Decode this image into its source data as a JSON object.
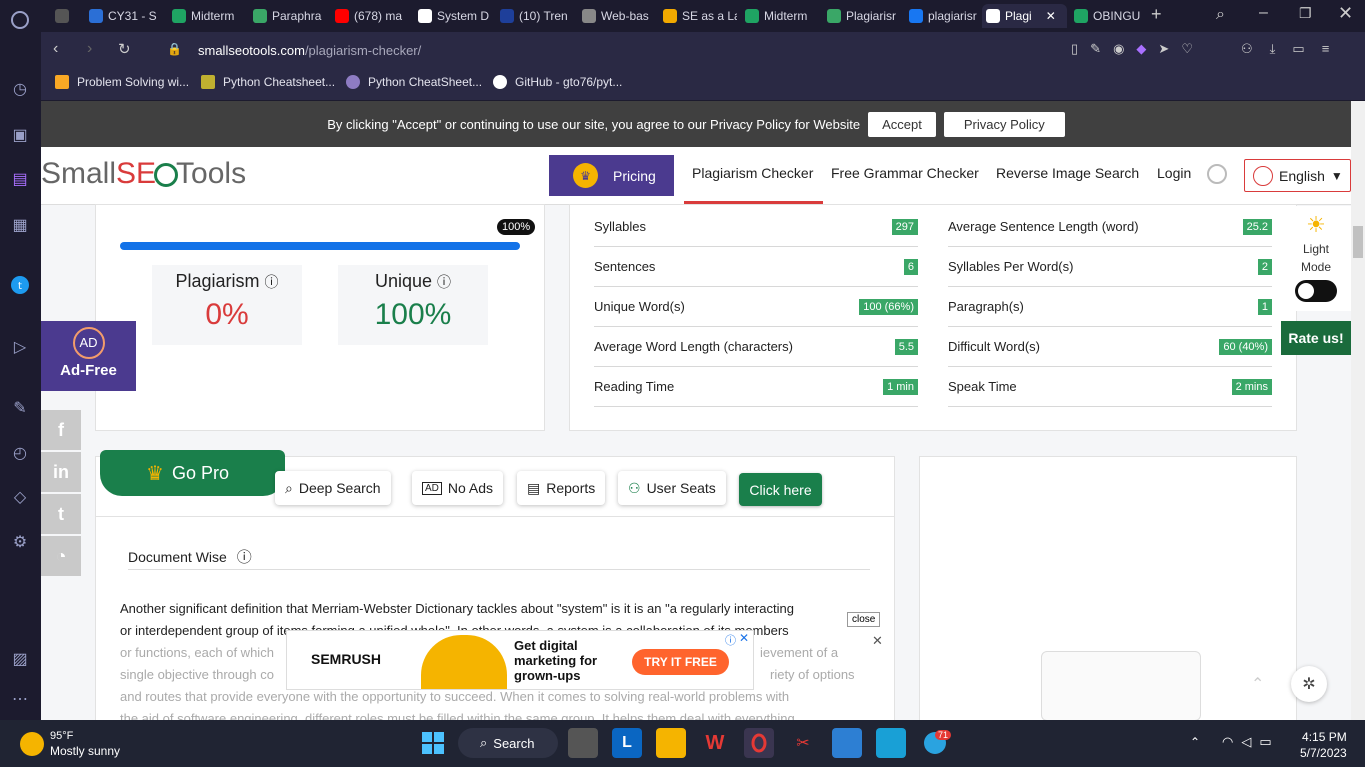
{
  "browser": {
    "tabs": [
      {
        "label": "CY31 - S",
        "color": "#2b6fd6"
      },
      {
        "label": "Midterm",
        "color": "#1fa463"
      },
      {
        "label": "Paraphra",
        "color": "#3aa767"
      },
      {
        "label": "(678) ma",
        "color": "#ff0000"
      },
      {
        "label": "System D",
        "color": "#ffffff"
      },
      {
        "label": "(10) Tren",
        "color": "#1e3f9a"
      },
      {
        "label": "Web-bas",
        "color": "#888888"
      },
      {
        "label": "SE as a La",
        "color": "#f2a900"
      },
      {
        "label": "Midterm",
        "color": "#1fa463"
      },
      {
        "label": "Plagiarisr",
        "color": "#3aa767"
      },
      {
        "label": "plagiarisr",
        "color": "#1877f2"
      },
      {
        "label": "Plagi",
        "color": "#ffffff"
      },
      {
        "label": "OBINGU",
        "color": "#1fa463"
      }
    ],
    "url_host": "smallseotools.com",
    "url_path": "/plagiarism-checker/",
    "bookmarks": [
      "Problem Solving wi...",
      "Python Cheatsheet...",
      "Python CheatSheet...",
      "GitHub - gto76/pyt..."
    ]
  },
  "cookie_banner": {
    "text": "By clicking \"Accept\" or continuing to use our site, you agree to our Privacy Policy for Website",
    "accept": "Accept",
    "privacy": "Privacy Policy"
  },
  "header": {
    "logo_a": "Small",
    "logo_b": "SE",
    "logo_c": "Tools",
    "pricing": "Pricing",
    "nav": [
      "Plagiarism Checker",
      "Free Grammar Checker",
      "Reverse Image Search",
      "Login"
    ],
    "language": "English"
  },
  "result": {
    "progress_label": "100%",
    "progress": 1.0,
    "plagiarism_label": "Plagiarism",
    "plagiarism_value": "0%",
    "unique_label": "Unique",
    "unique_value": "100%"
  },
  "stats_left": [
    {
      "label": "Syllables",
      "value": "297"
    },
    {
      "label": "Sentences",
      "value": "6"
    },
    {
      "label": "Unique Word(s)",
      "value": "100 (66%)"
    },
    {
      "label": "Average Word Length (characters)",
      "value": "5.5"
    },
    {
      "label": "Reading Time",
      "value": "1 min"
    }
  ],
  "stats_right": [
    {
      "label": "Average Sentence Length (word)",
      "value": "25.2"
    },
    {
      "label": "Syllables Per Word(s)",
      "value": "2"
    },
    {
      "label": "Paragraph(s)",
      "value": "1"
    },
    {
      "label": "Difficult Word(s)",
      "value": "60 (40%)"
    },
    {
      "label": "Speak Time",
      "value": "2 mins"
    }
  ],
  "side": {
    "light_mode_a": "Light",
    "light_mode_b": "Mode",
    "rate_us": "Rate us!",
    "ad_free": "Ad-Free",
    "ad_icon": "AD"
  },
  "pro": {
    "go_pro": "Go Pro",
    "features": [
      "Deep Search",
      "No Ads",
      "Reports",
      "User Seats"
    ],
    "click_here": "Click here"
  },
  "document": {
    "title": "Document Wise",
    "line1": "Another significant definition that Merriam-Webster Dictionary tackles about \"system\" is it is an \"a regularly interacting",
    "line2": "or interdependent group of items forming a unified whole\". In other words, a system is a collaboration of its members",
    "line3": "or functions, each of which",
    "line3b": "ievement of a",
    "line4": "single objective through co",
    "line4b": "riety of options",
    "line5": "and routes that provide everyone with the opportunity to succeed. When it comes to solving real-world problems with",
    "line6": "the aid of software engineering, different roles must be filled within the same group. It helps them deal with everything"
  },
  "ad": {
    "close": "close",
    "brand": "SEMRUSH",
    "headline": "Get digital marketing for grown-ups",
    "cta": "TRY IT FREE"
  },
  "taskbar": {
    "temp": "95°F",
    "weather": "Mostly sunny",
    "search": "Search",
    "time": "4:15 PM",
    "date": "5/7/2023",
    "badge": "71"
  }
}
